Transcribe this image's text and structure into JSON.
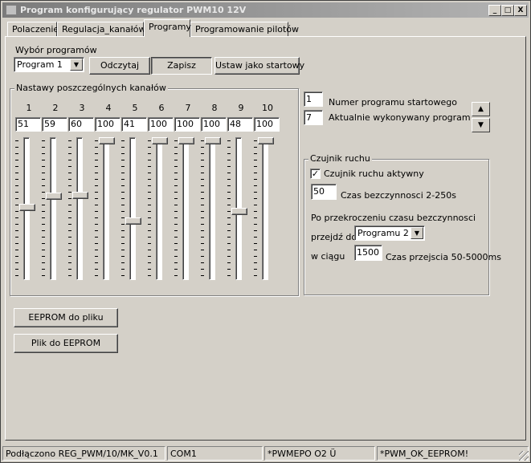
{
  "window": {
    "title": "Program konfigurujący regulator PWM10 12V",
    "controls": {
      "minimize": "_",
      "maximize": "□",
      "close": "X"
    }
  },
  "tabs": [
    {
      "label": "Polaczenie",
      "active": false
    },
    {
      "label": "Regulacja_kanałów",
      "active": false
    },
    {
      "label": "Programy",
      "active": true
    },
    {
      "label": "Programowanie pilotów",
      "active": false
    }
  ],
  "program_select": {
    "label": "Wybór programów",
    "selected": "Program 1",
    "read_button": "Odczytaj",
    "write_button": "Zapisz",
    "set_start_button": "Ustaw jako startowy"
  },
  "channels": {
    "group_label": "Nastawy poszczególnych kanałów",
    "items": [
      {
        "number": "1",
        "value": "51",
        "level": 51
      },
      {
        "number": "2",
        "value": "59",
        "level": 59
      },
      {
        "number": "3",
        "value": "60",
        "level": 60
      },
      {
        "number": "4",
        "value": "100",
        "level": 100
      },
      {
        "number": "5",
        "value": "41",
        "level": 41
      },
      {
        "number": "6",
        "value": "100",
        "level": 100
      },
      {
        "number": "7",
        "value": "100",
        "level": 100
      },
      {
        "number": "8",
        "value": "100",
        "level": 100
      },
      {
        "number": "9",
        "value": "48",
        "level": 48
      },
      {
        "number": "10",
        "value": "100",
        "level": 100
      }
    ]
  },
  "start_program": {
    "number_value": "1",
    "number_label": "Numer programu startowego",
    "current_value": "7",
    "current_label": "Aktualnie wykonywany program"
  },
  "motion_sensor": {
    "group_label": "Czujnik ruchu",
    "active_label": "Czujnik ruchu aktywny",
    "active_checked": true,
    "idle_value": "50",
    "idle_label": "Czas bezczynnosci 2-250s",
    "exceed_label": "Po przekroczeniu czasu bezczynnosci",
    "goto_label": "przejdź do",
    "goto_selected": "Programu 2",
    "within_label": "w ciągu",
    "transition_value": "1500",
    "transition_label": "Czas przejscia 50-5000ms"
  },
  "eeprom": {
    "to_file_button": "EEPROM do pliku",
    "from_file_button": "Plik do EEPROM"
  },
  "statusbar": {
    "connection": "Podłączono REG_PWM/10/MK_V0.1",
    "port": "COM1",
    "msg1": "*PWMEPO O2  Ü",
    "msg2": "*PWM_OK_EEPROM!"
  }
}
